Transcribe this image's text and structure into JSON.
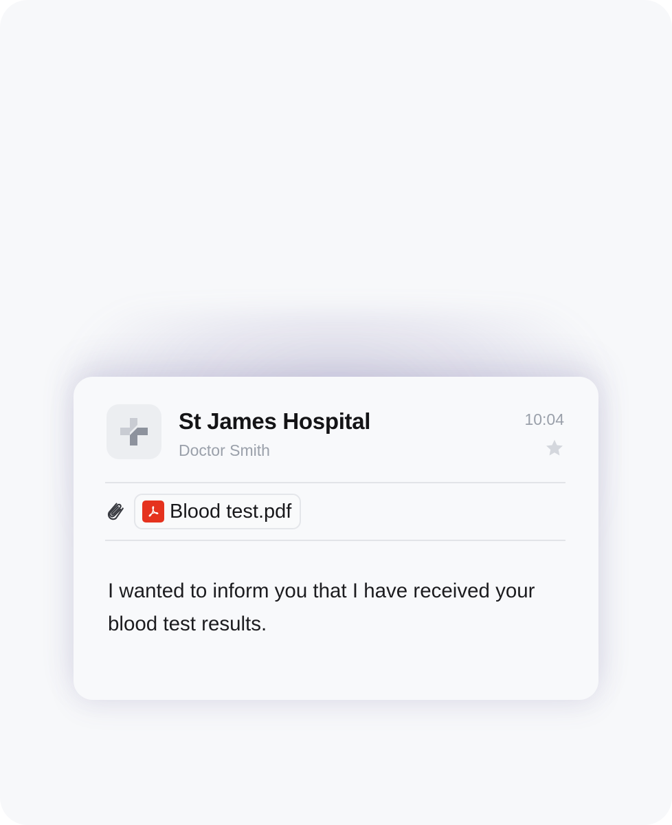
{
  "message": {
    "sender": "St James Hospital",
    "subsender": "Doctor Smith",
    "time": "10:04",
    "attachment": {
      "file_name": "Blood test.pdf",
      "icon": "pdf-icon"
    },
    "body": "I wanted to inform you that I have received your blood test results.",
    "icons": {
      "avatar": "medical-cross-icon",
      "star": "star-icon",
      "paperclip": "paperclip-icon"
    }
  },
  "colors": {
    "pdf_red": "#e5321e",
    "muted_text": "#9aa0aa",
    "primary_text": "#141416"
  }
}
